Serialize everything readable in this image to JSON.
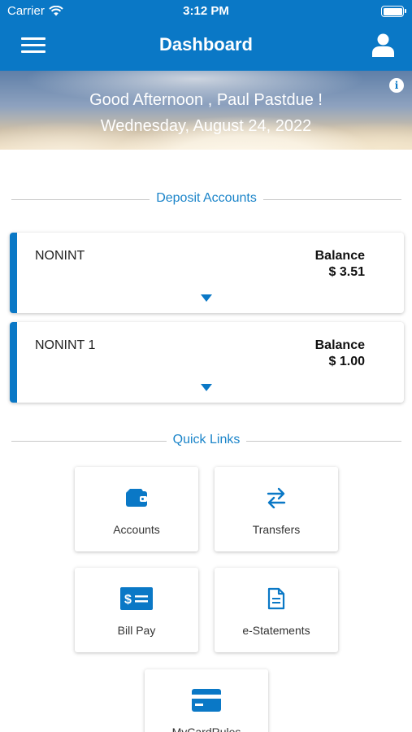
{
  "status_bar": {
    "carrier": "Carrier",
    "time": "3:12 PM"
  },
  "header": {
    "title": "Dashboard"
  },
  "hero": {
    "greeting": "Good Afternoon , Paul Pastdue !",
    "date": "Wednesday, August 24, 2022"
  },
  "deposit_section": {
    "title": "Deposit Accounts"
  },
  "accounts": [
    {
      "name": "NONINT",
      "balance_label": "Balance",
      "balance": "$ 3.51"
    },
    {
      "name": "NONINT 1",
      "balance_label": "Balance",
      "balance": "$ 1.00"
    }
  ],
  "quick_links_section": {
    "title": "Quick Links"
  },
  "quick_links": [
    {
      "label": "Accounts",
      "icon": "wallet-icon"
    },
    {
      "label": "Transfers",
      "icon": "transfer-arrows-icon"
    },
    {
      "label": "Bill Pay",
      "icon": "bill-pay-icon"
    },
    {
      "label": "e-Statements",
      "icon": "document-icon"
    },
    {
      "label": "MyCardRules",
      "icon": "credit-card-icon"
    }
  ],
  "colors": {
    "primary": "#0a78c6",
    "link_text": "#1a84c9",
    "divider": "#c8c8c8"
  }
}
